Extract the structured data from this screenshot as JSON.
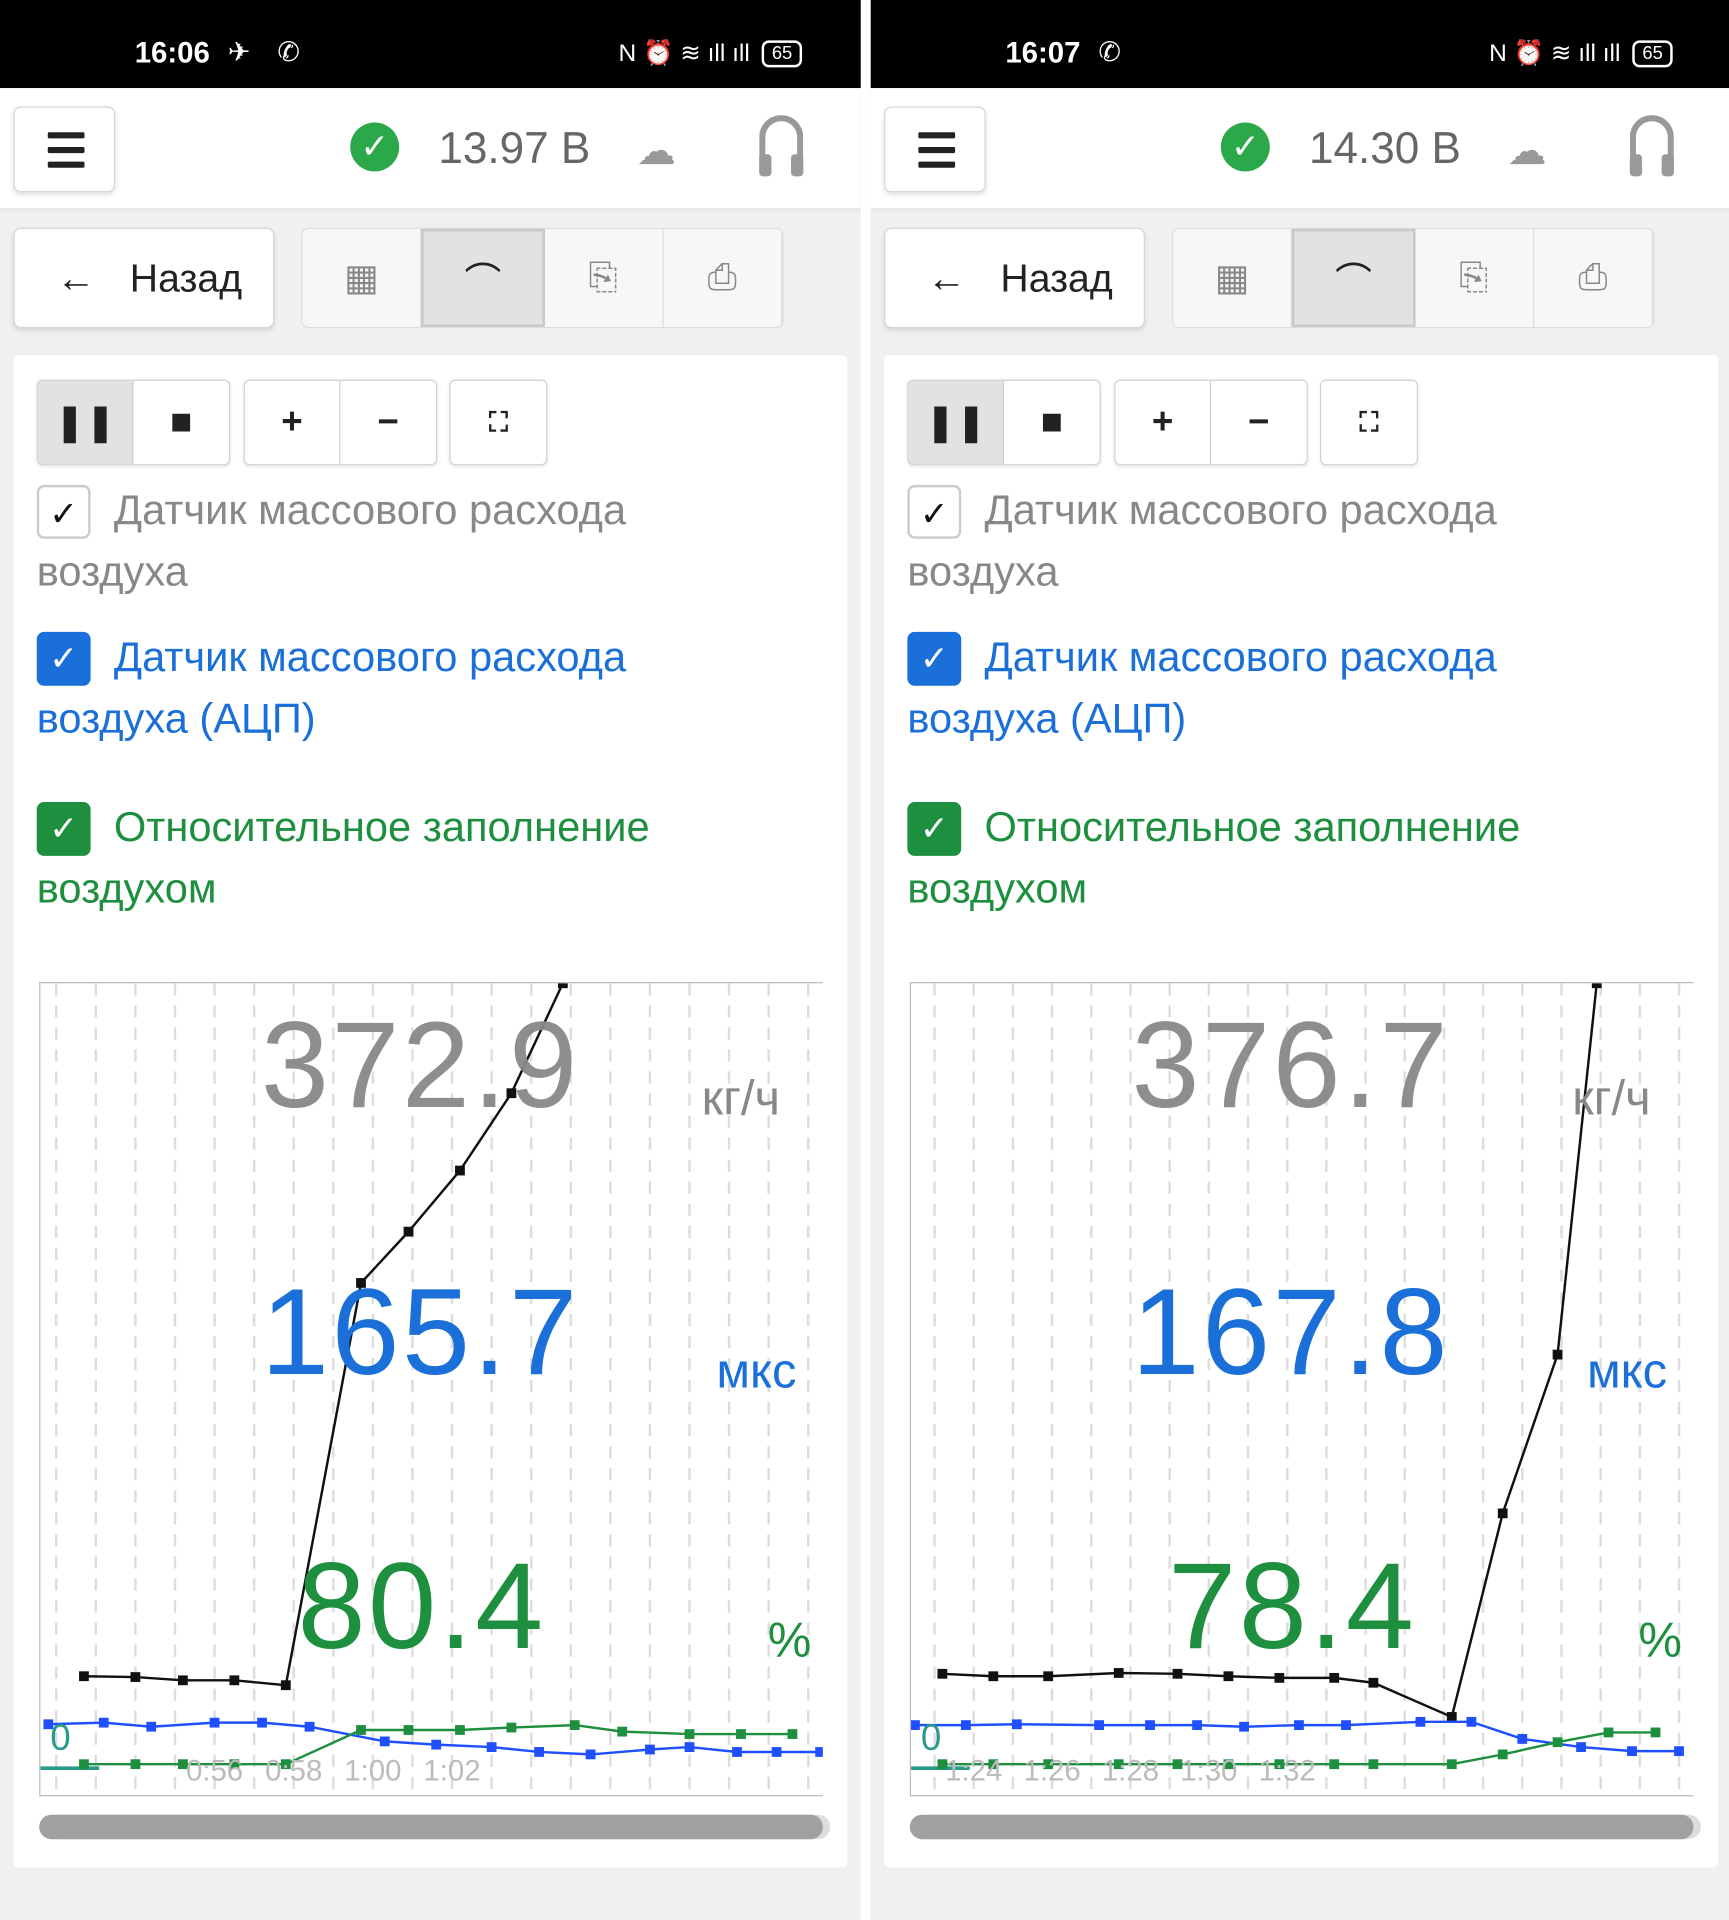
{
  "panels": [
    {
      "status": {
        "time": "16:06",
        "apps": "✈ ✆",
        "sys_icons": "N ⏰ ≋ ıll ıll",
        "battery": "65"
      },
      "header": {
        "voltage": "13.97 В",
        "status_icon": "check-circle-icon",
        "cloud_icon": "cloud-download-icon",
        "support_icon": "headset-icon"
      },
      "toolbar": {
        "back_label": "Назад",
        "views": [
          "grid",
          "chart",
          "export",
          "print"
        ],
        "active_view": "chart"
      },
      "controls": {
        "pause": "pause",
        "stop": "stop",
        "zoom_in": "+",
        "zoom_out": "−",
        "fit": "fit"
      },
      "sensors": [
        {
          "label": "Датчик массового расхода воздуха",
          "checked": true,
          "color": "#888888",
          "readout": "372.9",
          "unit": "кг/ч"
        },
        {
          "label": "Датчик массового расхода воздуха (АЦП)",
          "checked": true,
          "color": "#1a6fd8",
          "readout": "165.7",
          "unit": "мкс"
        },
        {
          "label": "Относительное заполнение воздухом",
          "checked": true,
          "color": "#1e8f3e",
          "readout": "80.4",
          "unit": "%"
        }
      ],
      "chart_data": {
        "type": "line",
        "x_domain": [
          51.6,
          71.4
        ],
        "y_range_percent": [
          0,
          100
        ],
        "zero_label": "0",
        "x_ticks": [
          {
            "v": 56,
            "label": "0:56"
          },
          {
            "v": 58,
            "label": "0:58"
          },
          {
            "v": 60,
            "label": "1:00"
          },
          {
            "v": 62,
            "label": "1:02"
          }
        ],
        "series": [
          {
            "name": "Датчик массового расхода воздуха",
            "color": "#111111",
            "x": [
              52.7,
              54.0,
              55.2,
              56.5,
              57.8,
              59.7,
              60.9,
              62.2,
              63.5,
              64.8
            ],
            "y": [
              14.9,
              14.8,
              14.4,
              14.4,
              13.8,
              63.2,
              69.5,
              77.0,
              86.5,
              100
            ]
          },
          {
            "name": "Датчик массового расхода воздуха (АЦП)",
            "color": "#1f4fff",
            "x": [
              51.8,
              53.2,
              54.4,
              56.0,
              57.2,
              58.4,
              60.3,
              61.6,
              63.0,
              64.2,
              65.5,
              67.0,
              68.0,
              69.2,
              70.2,
              71.3
            ],
            "y": [
              9.0,
              9.2,
              8.7,
              9.2,
              9.2,
              8.7,
              6.9,
              6.5,
              6.2,
              5.6,
              5.3,
              5.9,
              6.2,
              5.6,
              5.6,
              5.6
            ]
          },
          {
            "name": "Относительное заполнение воздухом",
            "color": "#1e8f3e",
            "x": [
              52.7,
              54.0,
              55.2,
              56.5,
              57.8,
              59.7,
              60.9,
              62.2,
              63.5,
              65.1,
              66.3,
              68.0,
              69.3,
              70.6
            ],
            "y": [
              4.1,
              4.1,
              4.1,
              4.1,
              4.1,
              8.3,
              8.3,
              8.3,
              8.6,
              8.9,
              8.1,
              7.8,
              7.8,
              7.8
            ]
          }
        ]
      }
    },
    {
      "status": {
        "time": "16:07",
        "apps": "✆",
        "sys_icons": "N ⏰ ≋ ıll ıll",
        "battery": "65"
      },
      "header": {
        "voltage": "14.30 В",
        "status_icon": "check-circle-icon",
        "cloud_icon": "cloud-download-icon",
        "support_icon": "headset-icon"
      },
      "toolbar": {
        "back_label": "Назад",
        "views": [
          "grid",
          "chart",
          "export",
          "print"
        ],
        "active_view": "chart"
      },
      "controls": {
        "pause": "pause",
        "stop": "stop",
        "zoom_in": "+",
        "zoom_out": "−",
        "fit": "fit"
      },
      "sensors": [
        {
          "label": "Датчик массового расхода воздуха",
          "checked": true,
          "color": "#888888",
          "readout": "376.7",
          "unit": "кг/ч"
        },
        {
          "label": "Датчик массового расхода воздуха (АЦП)",
          "checked": true,
          "color": "#1a6fd8",
          "readout": "167.8",
          "unit": "мкс"
        },
        {
          "label": "Относительное заполнение воздухом",
          "checked": true,
          "color": "#1e8f3e",
          "readout": "78.4",
          "unit": "%"
        }
      ],
      "chart_data": {
        "type": "line",
        "x_domain": [
          82.4,
          102.4
        ],
        "y_range_percent": [
          0,
          100
        ],
        "zero_label": "0",
        "x_ticks": [
          {
            "v": 84,
            "label": "1:24"
          },
          {
            "v": 86,
            "label": "1:26"
          },
          {
            "v": 88,
            "label": "1:28"
          },
          {
            "v": 90,
            "label": "1:30"
          },
          {
            "v": 92,
            "label": "1:32"
          }
        ],
        "series": [
          {
            "name": "Датчик массового расхода воздуха",
            "color": "#111111",
            "x": [
              83.2,
              84.5,
              85.9,
              87.7,
              89.2,
              90.5,
              91.8,
              93.2,
              94.2,
              96.2,
              97.5,
              98.9,
              99.9
            ],
            "y": [
              15.2,
              14.9,
              14.9,
              15.3,
              15.2,
              14.9,
              14.7,
              14.7,
              14.1,
              9.9,
              34.9,
              54.4,
              100
            ]
          },
          {
            "name": "Датчик массового расхода воздуха (АЦП)",
            "color": "#1f4fff",
            "x": [
              82.5,
              83.8,
              85.1,
              87.2,
              88.5,
              89.7,
              90.9,
              92.3,
              93.5,
              95.4,
              96.7,
              98.0,
              99.5,
              100.8,
              102.0
            ],
            "y": [
              8.9,
              8.9,
              9.0,
              8.9,
              8.9,
              8.9,
              8.7,
              8.9,
              8.9,
              9.3,
              9.3,
              7.2,
              6.2,
              5.7,
              5.7
            ]
          },
          {
            "name": "Относительное заполнение воздухом",
            "color": "#1e8f3e",
            "x": [
              83.2,
              84.5,
              85.9,
              87.7,
              89.2,
              90.5,
              91.8,
              93.2,
              94.2,
              96.2,
              97.5,
              98.9,
              100.2,
              101.4
            ],
            "y": [
              4.1,
              4.1,
              4.1,
              4.1,
              4.1,
              4.1,
              4.1,
              4.1,
              4.1,
              4.1,
              5.3,
              6.8,
              8.0,
              8.0
            ]
          }
        ]
      }
    }
  ]
}
